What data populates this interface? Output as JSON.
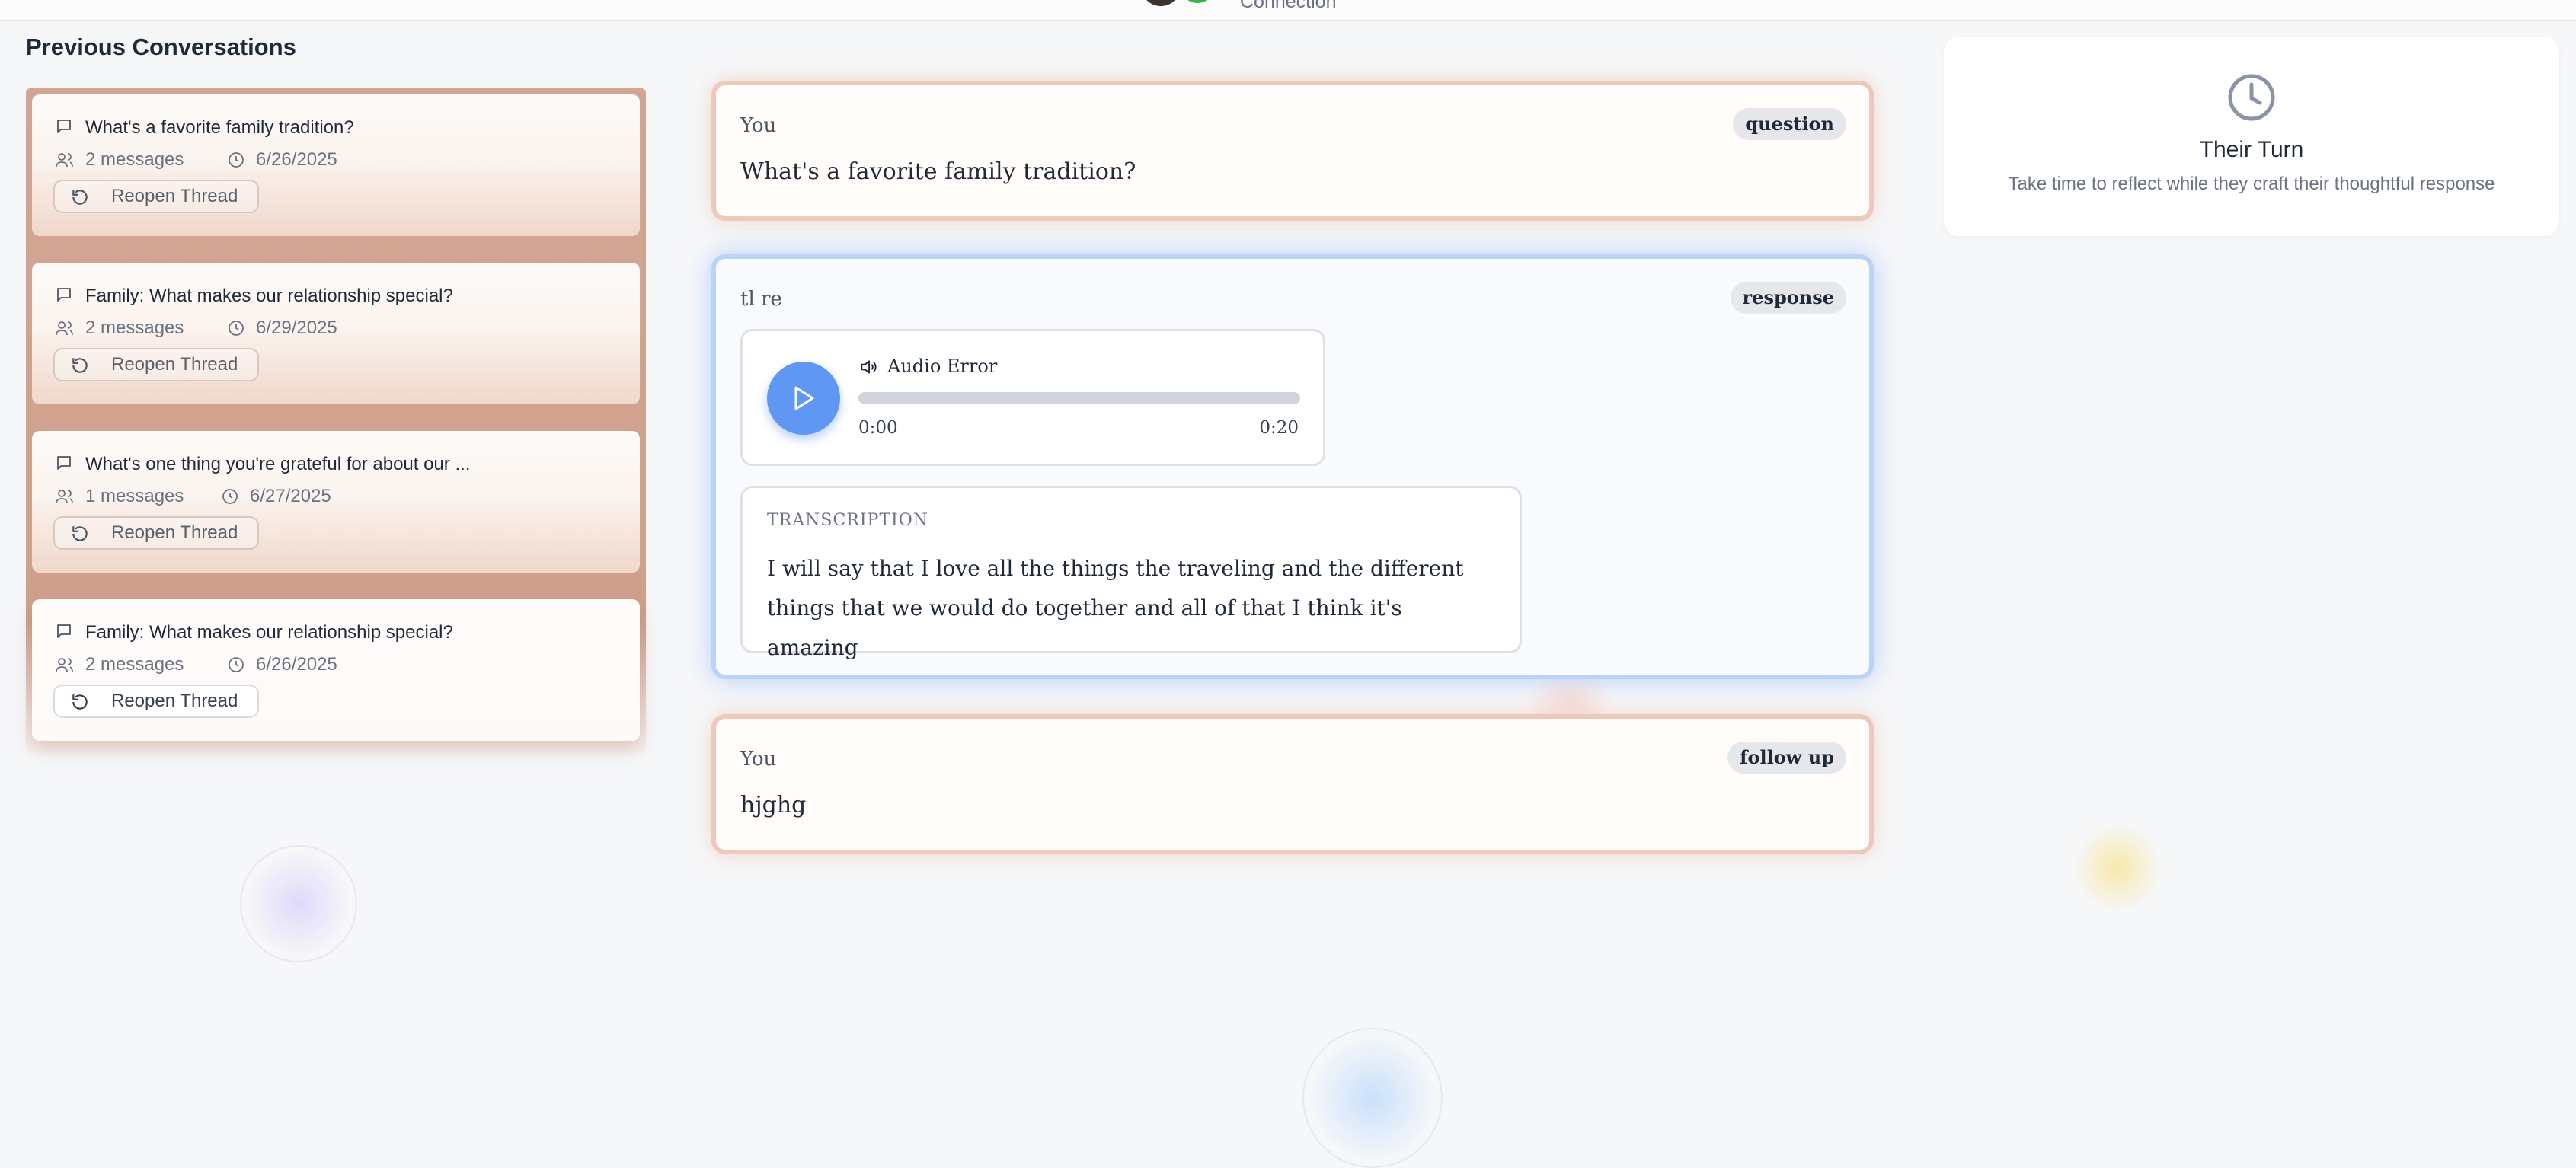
{
  "top": {
    "label": "Connection"
  },
  "sidebar": {
    "title": "Previous Conversations",
    "threads": [
      {
        "title": "What's a favorite family tradition?",
        "messages": "2 messages",
        "date": "6/26/2025",
        "action": "Reopen Thread"
      },
      {
        "title": "Family: What makes our relationship special?",
        "messages": "2 messages",
        "date": "6/29/2025",
        "action": "Reopen Thread"
      },
      {
        "title": "What's one thing you're grateful for about our ...",
        "messages": "1 messages",
        "date": "6/27/2025",
        "action": "Reopen Thread"
      },
      {
        "title": "Family: What makes our relationship special?",
        "messages": "2 messages",
        "date": "6/26/2025",
        "action": "Reopen Thread"
      }
    ]
  },
  "conversation": {
    "question": {
      "author": "You",
      "tag": "question",
      "text": "What's a favorite family tradition?"
    },
    "response": {
      "author": "tl re",
      "tag": "response",
      "audio": {
        "status": "Audio Error",
        "current": "0:00",
        "total": "0:20",
        "progress_fraction": 0
      },
      "transcription_label": "TRANSCRIPTION",
      "transcription": "I will say that I love all the things the traveling and the different things that we would do together and all of that I think it's amazing"
    },
    "followup": {
      "author": "You",
      "tag": "follow up",
      "text": "hjghg"
    }
  },
  "status_panel": {
    "title": "Their Turn",
    "subtitle": "Take time to reflect while they craft their thoughtful response"
  },
  "colors": {
    "play_button": "#5f97f2",
    "question_border": "#ecc9ba",
    "response_border": "#bcd3f8",
    "sidebar_bg": "#d3a594"
  }
}
